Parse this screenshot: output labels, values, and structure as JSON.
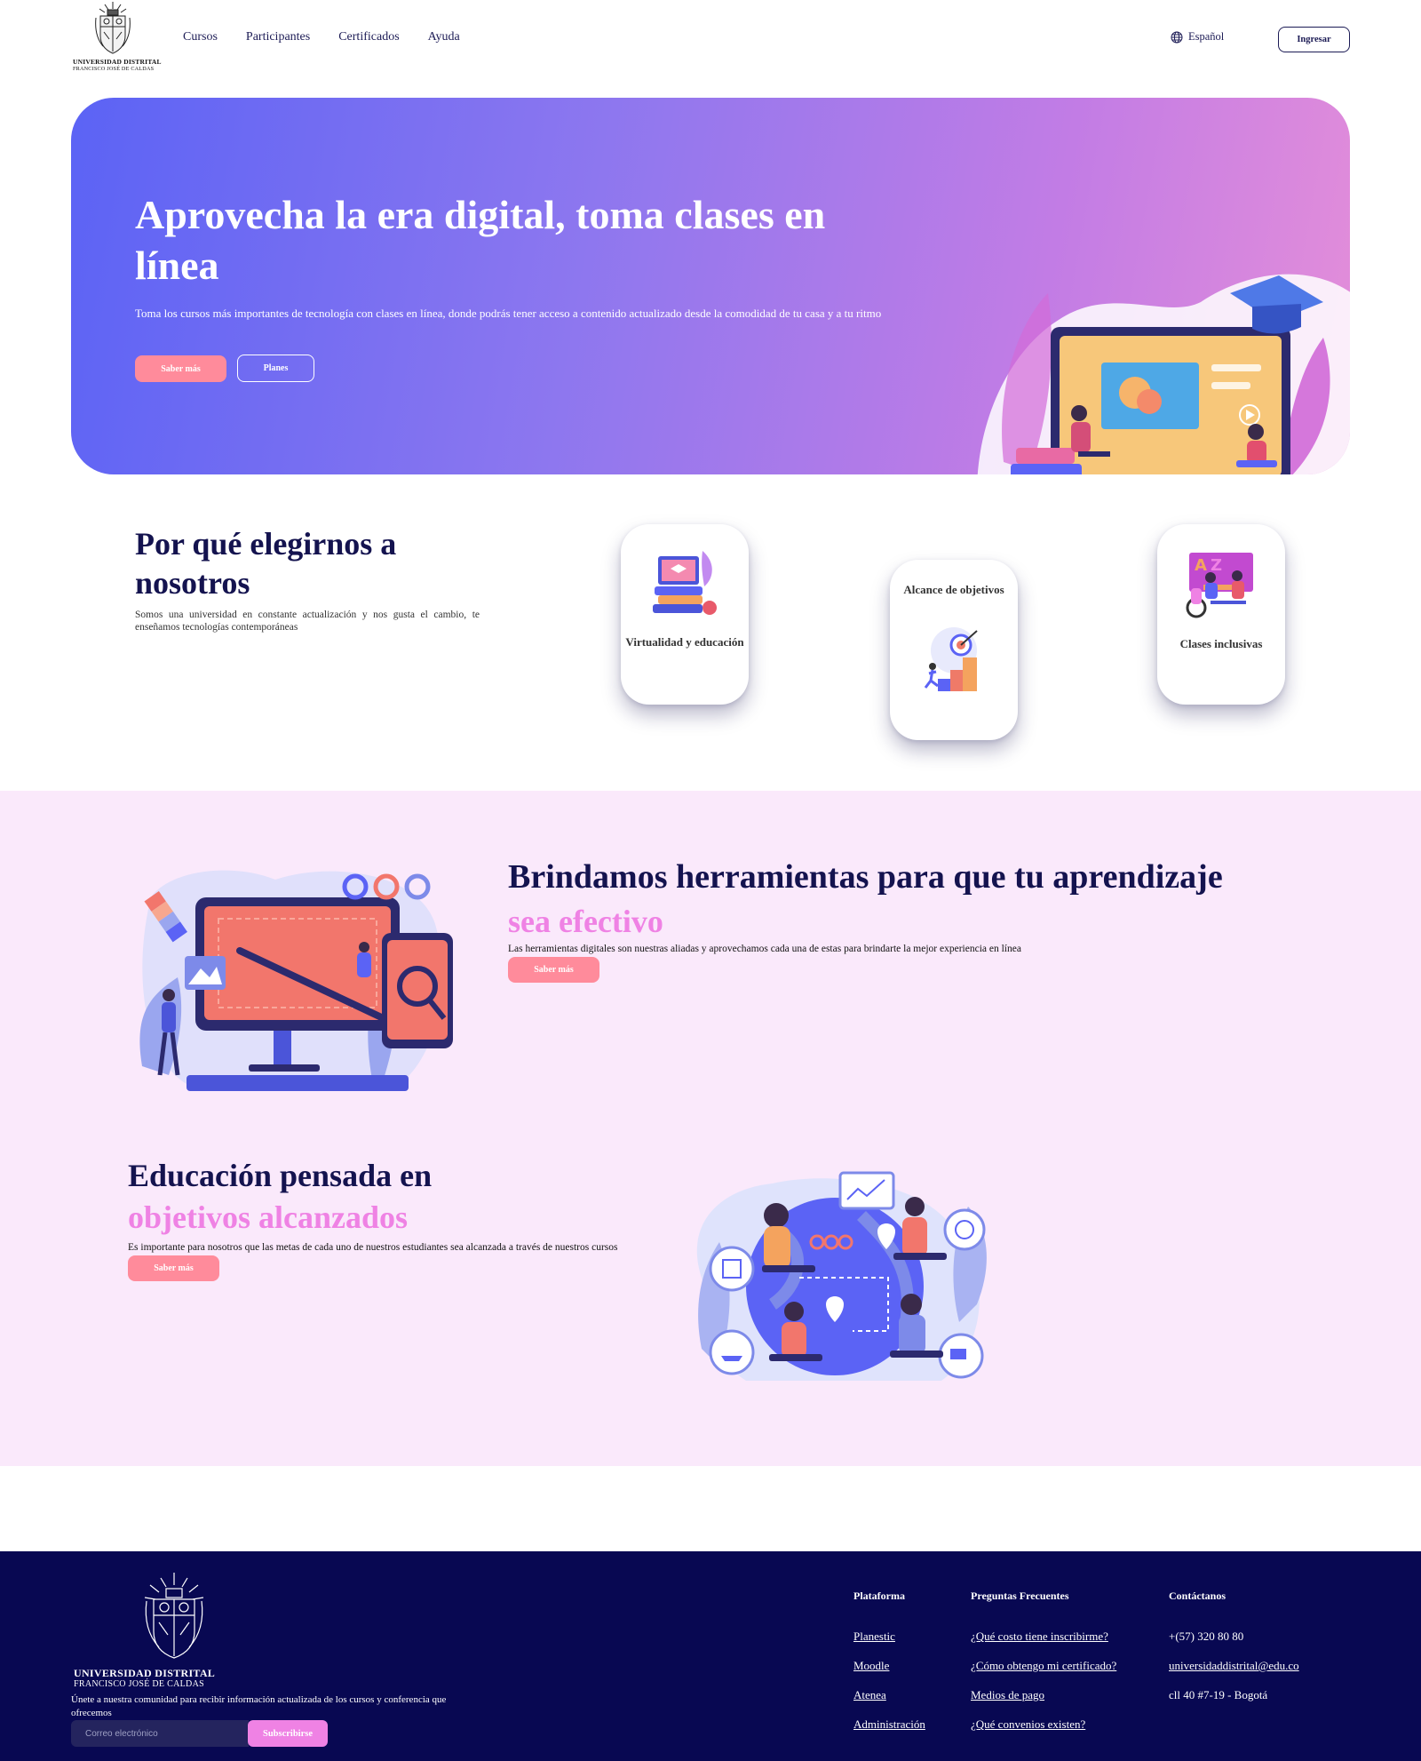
{
  "header": {
    "logo": {
      "line1": "UNIVERSIDAD DISTRITAL",
      "line2": "FRANCISCO JOSÉ DE CALDAS"
    },
    "nav": [
      "Cursos",
      "Participantes",
      "Certificados",
      "Ayuda"
    ],
    "language": "Español",
    "login_label": "Ingresar"
  },
  "hero": {
    "title": "Aprovecha la era digital, toma clases en línea",
    "subtitle": "Toma los cursos más importantes de tecnología con clases en línea, donde podrás tener acceso a contenido actualizado desde la comodidad de tu casa y a tu ritmo",
    "btn_primary": "Saber más",
    "btn_secondary": "Planes"
  },
  "why": {
    "title": "Por qué elegirnos a nosotros",
    "subtitle": "Somos una universidad en constante actualización y nos gusta el cambio, te enseñamos tecnologías contemporáneas",
    "cards": [
      {
        "label": "Virtualidad y educación"
      },
      {
        "label": "Alcance de objetivos"
      },
      {
        "label": "Clases inclusivas"
      }
    ]
  },
  "tools": {
    "title": "Brindamos herramientas para que tu aprendizaje",
    "highlight": "sea efectivo",
    "subtitle": "Las herramientas digitales son nuestras aliadas y aprovechamos cada una de estas para brindarte la mejor experiencia en línea",
    "button": "Saber más"
  },
  "education": {
    "title": "Educación pensada en",
    "highlight": "objetivos alcanzados",
    "subtitle": "Es importante para nosotros que las metas de cada uno de nuestros estudiantes sea alcanzada a través de nuestros cursos",
    "button": "Saber más"
  },
  "footer": {
    "logo": {
      "line1": "UNIVERSIDAD DISTRITAL",
      "line2": "FRANCISCO JOSÉ DE CALDAS"
    },
    "join_text": "Únete a nuestra comunidad para recibir información actualizada de los cursos y conferencia que ofrecemos",
    "email_placeholder": "Correo electrónico",
    "subscribe_label": "Subscribirse",
    "columns": {
      "platform": {
        "title": "Plataforma",
        "links": [
          "Planestic",
          "Moodle",
          "Atenea",
          "Administración"
        ]
      },
      "faq": {
        "title": "Preguntas Frecuentes",
        "links": [
          "¿Qué costo tiene inscribirme?",
          "¿Cómo obtengo mi certificado?",
          "Medios de pago",
          "¿Qué convenios existen?"
        ]
      },
      "contact": {
        "title": "Contáctanos",
        "phone": "+(57) 320 80 80",
        "email": "universidaddistrital@edu.co",
        "address": "cll 40 #7-19 - Bogotá"
      }
    }
  },
  "colors": {
    "navy": "#14134f",
    "pink_button": "#ff8b9b",
    "highlight": "#ef82e4",
    "band": "#fae9fb",
    "footer": "#080852"
  }
}
